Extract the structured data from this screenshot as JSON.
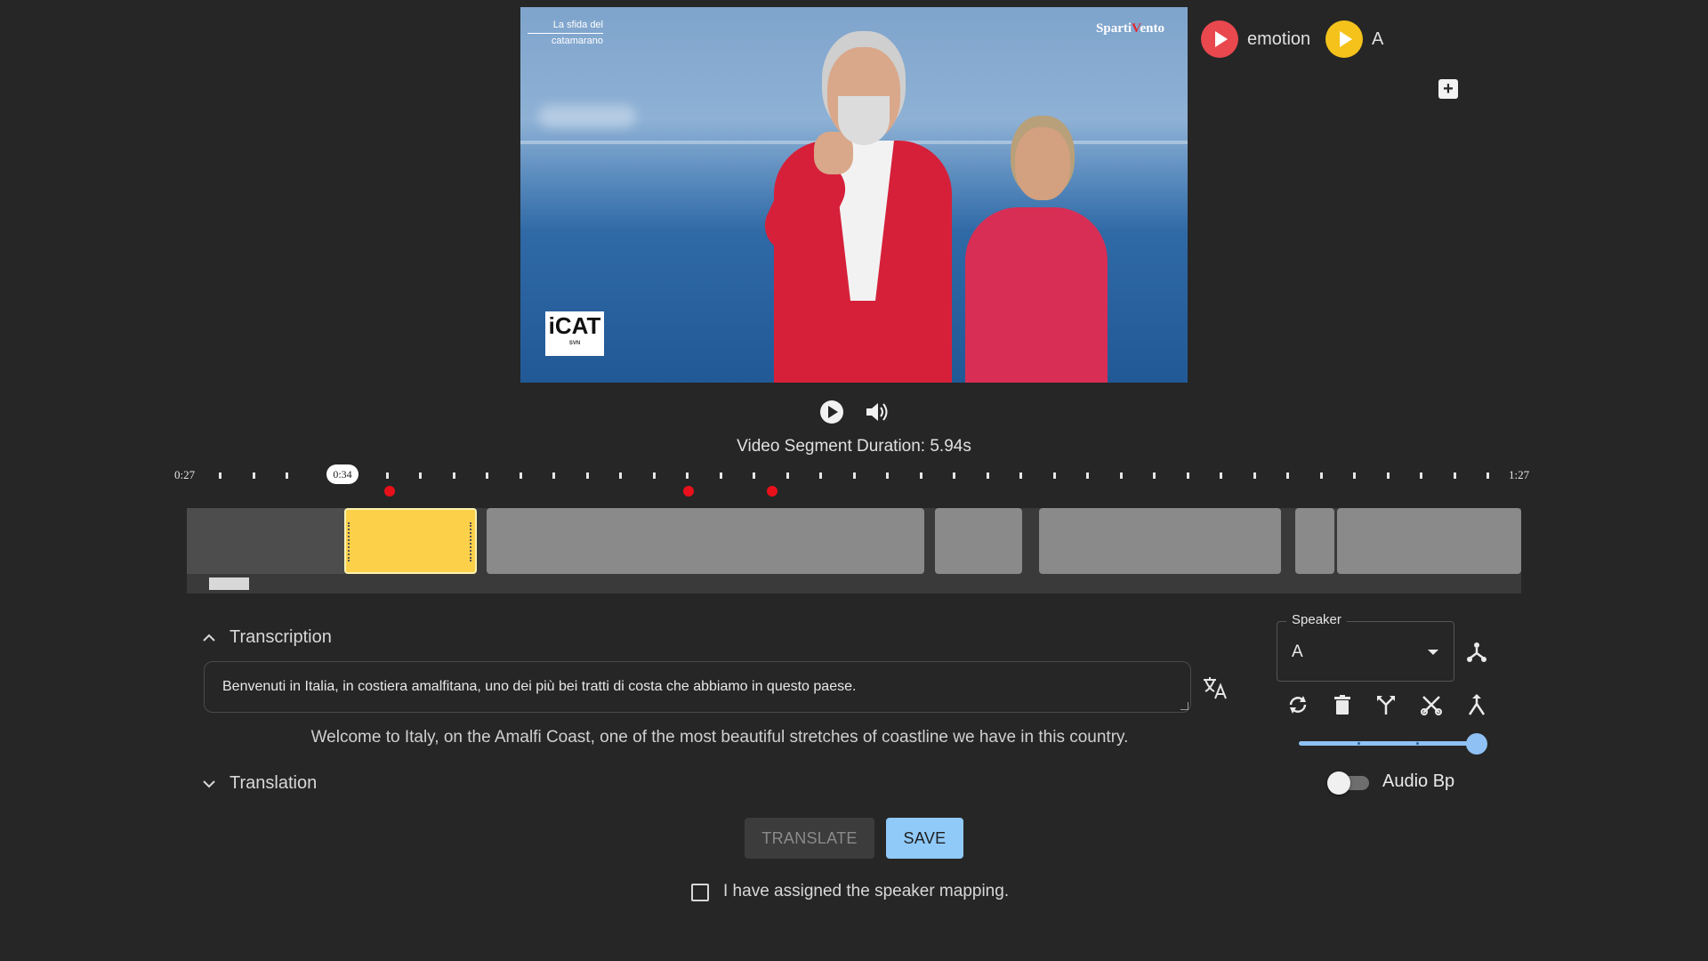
{
  "video": {
    "logo_top_left_line1": "La sfida del",
    "logo_top_left_line2": "catamarano",
    "logo_top_right": "Sparti",
    "logo_top_right_v": "V",
    "logo_top_right_end": "ento",
    "logo_cat": "iCAT",
    "logo_cat_sub": "SVN"
  },
  "emotion_bar": {
    "items": [
      {
        "label": "emotion",
        "color": "#e8484e"
      },
      {
        "label": "A",
        "color": "#f5c21b"
      }
    ]
  },
  "controls": {
    "duration_text": "Video Segment Duration: 5.94s"
  },
  "timeline": {
    "start_time": "0:27",
    "end_time": "1:27",
    "current_time": "0:34",
    "marker_color": "#e8101a",
    "active_segment_color": "#fdd04a"
  },
  "transcription": {
    "header": "Transcription",
    "text": "Benvenuti in Italia, in costiera amalfitana, uno dei più bei tratti di costa che abbiamo in questo paese.",
    "english": "Welcome to Italy, on the Amalfi Coast, one of the most beautiful stretches of coastline we have in this country."
  },
  "translation": {
    "header": "Translation"
  },
  "speaker": {
    "legend": "Speaker",
    "value": "A"
  },
  "audio": {
    "label": "Audio Bp"
  },
  "buttons": {
    "translate": "TRANSLATE",
    "save": "SAVE"
  },
  "confirm": {
    "label": "I have assigned the speaker mapping."
  }
}
